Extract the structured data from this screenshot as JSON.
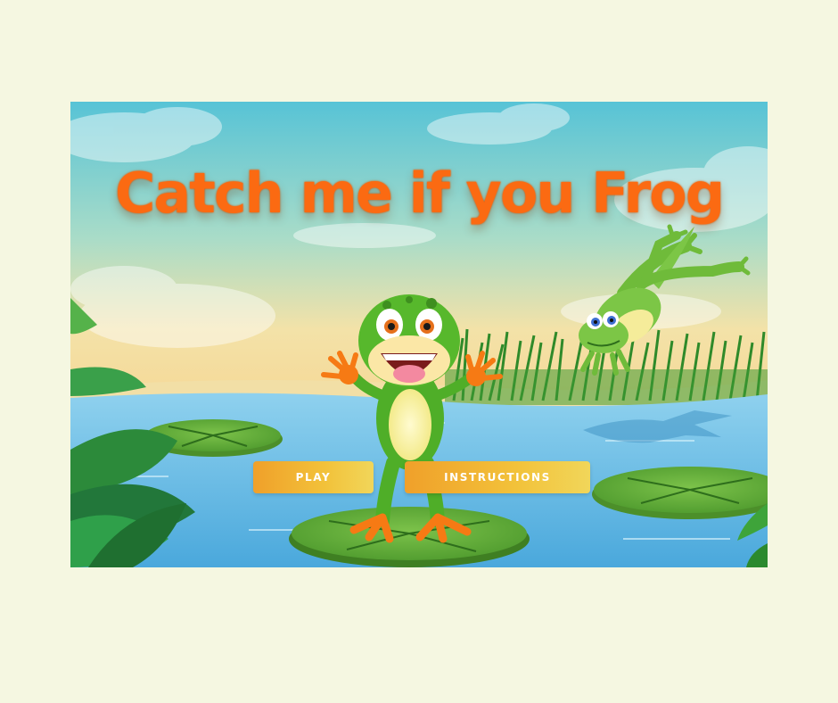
{
  "game": {
    "title": "Catch me if you Frog",
    "buttons": {
      "play_label": "PLAY",
      "instructions_label": "INSTRUCTIONS"
    }
  },
  "colors": {
    "page_background": "#f5f7e1",
    "title": "#fb6a12",
    "button_gradient_start": "#f0a02a",
    "button_gradient_end": "#f1d65a",
    "water": "#5fb6e0",
    "lily_pad": "#6cae3c",
    "frog": "#5fbf2a"
  }
}
